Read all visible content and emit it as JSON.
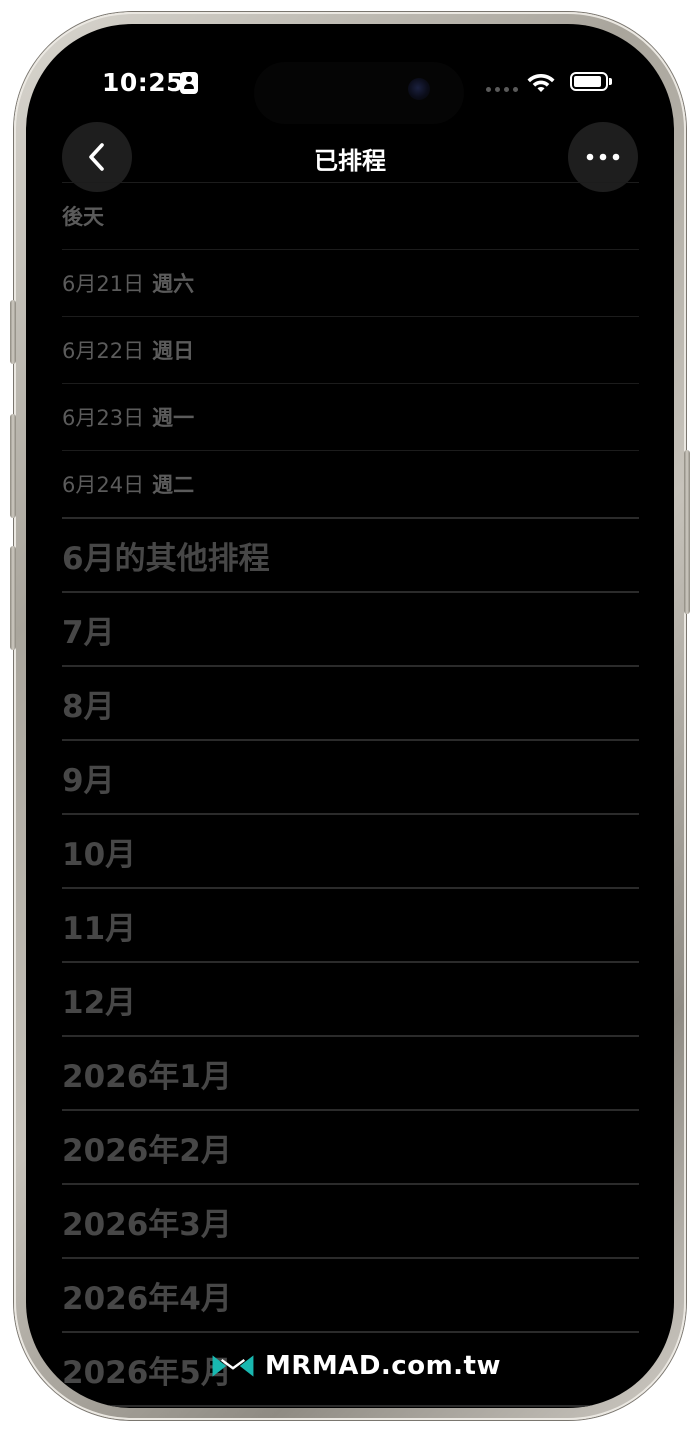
{
  "status_bar": {
    "time": "10:25"
  },
  "nav": {
    "title": "已排程",
    "back_icon": "chevron-left-icon",
    "more_icon": "ellipsis-icon"
  },
  "list": {
    "top_label": "後天",
    "days": [
      {
        "date": "6月21日",
        "weekday": "週六"
      },
      {
        "date": "6月22日",
        "weekday": "週日"
      },
      {
        "date": "6月23日",
        "weekday": "週一"
      },
      {
        "date": "6月24日",
        "weekday": "週二"
      }
    ],
    "months": [
      "6月的其他排程",
      "7月",
      "8月",
      "9月",
      "10月",
      "11月",
      "12月",
      "2026年1月",
      "2026年2月",
      "2026年3月",
      "2026年4月",
      "2026年5月"
    ]
  },
  "watermark": {
    "text": "MRMAD.com.tw",
    "accent": "#19b8b0"
  }
}
